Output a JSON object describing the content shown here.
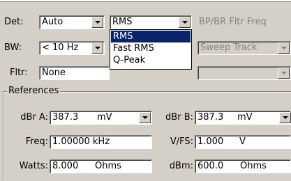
{
  "top": {
    "det_label": "Det:",
    "det_value": "Auto",
    "detector_value": "RMS",
    "bp_label": "BP/BR Fltr Freq",
    "bw_label": "BW:",
    "bw_value": "< 10 Hz",
    "sweep_value": "Sweep Track",
    "fltr_label": "Fltr:",
    "fltr_value": "None",
    "fltr_right_value": ""
  },
  "popup": {
    "items": [
      "RMS",
      "Fast RMS",
      "Q-Peak"
    ],
    "selected_index": 0
  },
  "references": {
    "title": "References",
    "dbra_label": "dBr A:",
    "dbra_value": "387.3",
    "dbra_unit": "mV",
    "dbrb_label": "dBr B:",
    "dbrb_value": "387.3",
    "dbrb_unit": "mV",
    "freq_label": "Freq:",
    "freq_value": "1.00000 kHz",
    "vfs_label": "V/FS:",
    "vfs_value": "1.000",
    "vfs_unit": "V",
    "watts_label": "Watts:",
    "watts_value": "8.000",
    "watts_unit": "Ohms",
    "dbm_label": "dBm:",
    "dbm_value": "600.0",
    "dbm_unit": "Ohms"
  }
}
